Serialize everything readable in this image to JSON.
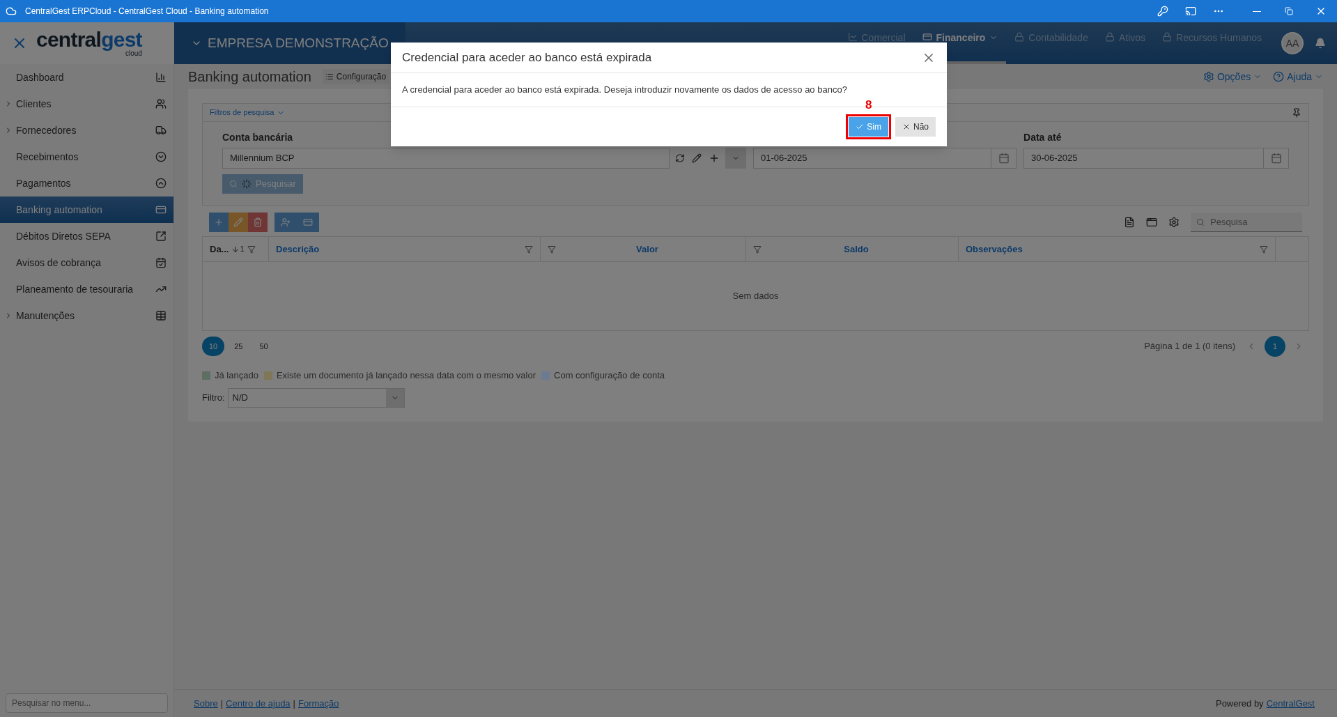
{
  "window": {
    "title": "CentralGest ERPCloud - CentralGest Cloud - Banking automation"
  },
  "app_header": {
    "logo_main": "central",
    "logo_accent": "gest",
    "logo_sub": "cloud",
    "company": "EMPRESA DEMONSTRAÇÃO",
    "avatar": "AA",
    "nav": [
      {
        "label": "Comercial",
        "selected": false,
        "locked": false,
        "has_menu": false
      },
      {
        "label": "Financeiro",
        "selected": true,
        "locked": false,
        "has_menu": true
      },
      {
        "label": "Contabilidade",
        "selected": false,
        "locked": true,
        "has_menu": false
      },
      {
        "label": "Ativos",
        "selected": false,
        "locked": true,
        "has_menu": false
      },
      {
        "label": "Recursos Humanos",
        "selected": false,
        "locked": true,
        "has_menu": false
      }
    ]
  },
  "sidebar": {
    "search_placeholder": "Pesquisar no menu...",
    "items": [
      {
        "label": "Dashboard",
        "selected": false,
        "expandable": false
      },
      {
        "label": "Clientes",
        "selected": false,
        "expandable": true
      },
      {
        "label": "Fornecedores",
        "selected": false,
        "expandable": true
      },
      {
        "label": "Recebimentos",
        "selected": false,
        "expandable": false
      },
      {
        "label": "Pagamentos",
        "selected": false,
        "expandable": false
      },
      {
        "label": "Banking automation",
        "selected": true,
        "expandable": false
      },
      {
        "label": "Débitos Diretos SEPA",
        "selected": false,
        "expandable": false
      },
      {
        "label": "Avisos de cobrança",
        "selected": false,
        "expandable": false
      },
      {
        "label": "Planeamento de tesouraria",
        "selected": false,
        "expandable": false
      },
      {
        "label": "Manutenções",
        "selected": false,
        "expandable": true
      }
    ]
  },
  "page": {
    "title": "Banking automation",
    "config_button": "Configuração",
    "options": "Opções",
    "help": "Ajuda"
  },
  "filters": {
    "title": "Filtros de pesquisa",
    "account_label": "Conta bancária",
    "account_value": "Millennium BCP",
    "date_from_value": "01-06-2025",
    "date_to_label": "Data até",
    "date_to_value": "30-06-2025",
    "search_button": "Pesquisar"
  },
  "table": {
    "search_placeholder": "Pesquisa",
    "columns": [
      {
        "label": "Da...",
        "sort_index": "1"
      },
      {
        "label": "Descrição"
      },
      {
        "label": "Valor"
      },
      {
        "label": "Saldo"
      },
      {
        "label": "Observações"
      }
    ],
    "empty_text": "Sem dados",
    "page_sizes": [
      {
        "label": "10",
        "selected": true
      },
      {
        "label": "25",
        "selected": false
      },
      {
        "label": "50",
        "selected": false
      }
    ],
    "page_info": "Página 1 de 1 (0 itens)",
    "pages": [
      {
        "label": "1",
        "selected": true
      }
    ]
  },
  "legend": [
    {
      "label": "Já lançado",
      "color": "#5e6e62"
    },
    {
      "label": "Existe um documento já lançado nessa data com o mesmo valor",
      "color": "#807658"
    },
    {
      "label": "Com configuração de conta",
      "color": "#6c7b92"
    }
  ],
  "filter": {
    "label": "Filtro:",
    "value": "N/D"
  },
  "footer": {
    "links": [
      {
        "label": "Sobre"
      },
      {
        "separator": "|",
        "label": "Centro de ajuda"
      },
      {
        "separator": "|",
        "label": "Formação"
      }
    ],
    "powered_by": "Powered by",
    "powered_link": "CentralGest"
  },
  "dialog": {
    "title": "Credencial para aceder ao banco está expirada",
    "message": "A credencial para aceder ao banco está expirada. Deseja introduzir novamente os dados de acesso ao banco?",
    "step_marker": "8",
    "buttons": [
      {
        "label": "Sim",
        "kind": "primary",
        "highlighted": true
      },
      {
        "label": "Não",
        "kind": "secondary",
        "highlighted": false
      }
    ]
  }
}
